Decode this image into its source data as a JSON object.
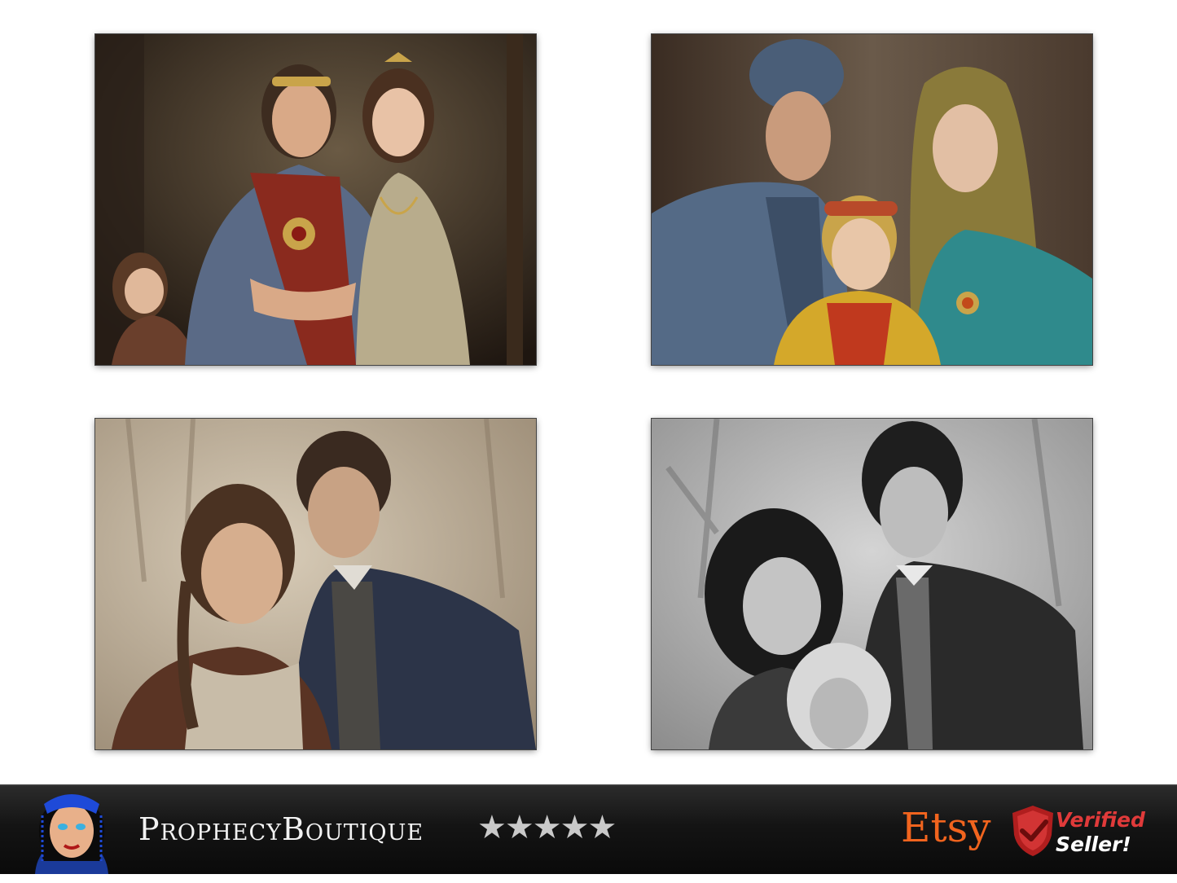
{
  "shop": {
    "name": "ProphecyBoutique",
    "rating_stars": "★★★★★",
    "rating": 5,
    "marketplace": "Etsy",
    "badge_line1": "Verified",
    "badge_line2": "Seller!"
  },
  "colors": {
    "etsy_orange": "#f1641e",
    "verified_red": "#e03a3a",
    "banner_bg": "#111111"
  },
  "icons": [
    "avatar-icon",
    "shield-check-icon"
  ],
  "images": [
    {
      "name": "medieval-royal-family-portrait"
    },
    {
      "name": "renaissance-family-portrait"
    },
    {
      "name": "sepia-couple-portrait"
    },
    {
      "name": "monochrome-family-portrait"
    }
  ]
}
